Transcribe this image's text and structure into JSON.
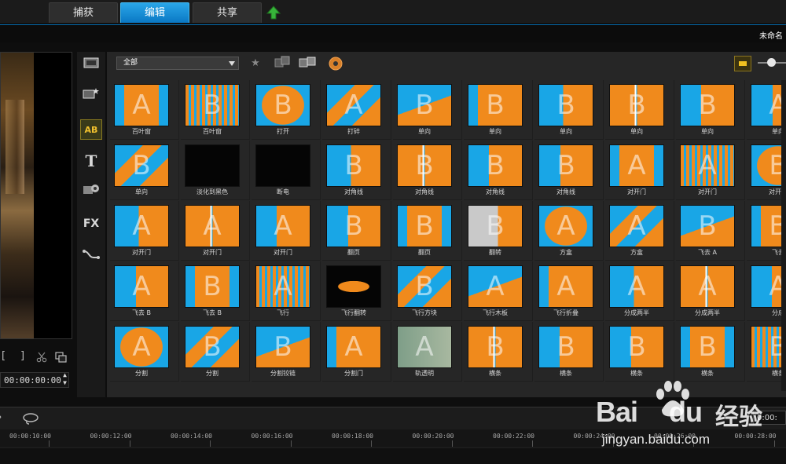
{
  "tabs": [
    {
      "label": "捕获",
      "active": false
    },
    {
      "label": "编辑",
      "active": true
    },
    {
      "label": "共享",
      "active": false
    }
  ],
  "project_name": "未命名",
  "preview": {
    "timecode": "00:00:00:00",
    "mark_in": "[",
    "mark_out": "]"
  },
  "library": {
    "category_selected": "全部",
    "rows": [
      [
        {
          "label": "百叶窗",
          "letter": "A"
        },
        {
          "label": "百叶窗",
          "letter": "B"
        },
        {
          "label": "打开",
          "letter": "B"
        },
        {
          "label": "打碎",
          "letter": "A"
        },
        {
          "label": "单向",
          "letter": "B"
        },
        {
          "label": "单向",
          "letter": "B"
        },
        {
          "label": "单向",
          "letter": "B"
        },
        {
          "label": "单向",
          "letter": "B"
        },
        {
          "label": "单向",
          "letter": "B"
        },
        {
          "label": "单向",
          "letter": "A"
        }
      ],
      [
        {
          "label": "单向",
          "letter": "B"
        },
        {
          "label": "淡化到黑色",
          "letter": ""
        },
        {
          "label": "断电",
          "letter": ""
        },
        {
          "label": "对角线",
          "letter": "B"
        },
        {
          "label": "对角线",
          "letter": "B"
        },
        {
          "label": "对角线",
          "letter": "B"
        },
        {
          "label": "对角线",
          "letter": "B"
        },
        {
          "label": "对开门",
          "letter": "A"
        },
        {
          "label": "对开门",
          "letter": "A"
        },
        {
          "label": "对开门",
          "letter": "B"
        }
      ],
      [
        {
          "label": "对开门",
          "letter": "A"
        },
        {
          "label": "对开门",
          "letter": "A"
        },
        {
          "label": "对开门",
          "letter": "A"
        },
        {
          "label": "翻页",
          "letter": "B"
        },
        {
          "label": "翻页",
          "letter": "B"
        },
        {
          "label": "翻转",
          "letter": "B"
        },
        {
          "label": "方盒",
          "letter": "A"
        },
        {
          "label": "方盒",
          "letter": "A"
        },
        {
          "label": "飞去 A",
          "letter": "B"
        },
        {
          "label": "飞去",
          "letter": "B"
        }
      ],
      [
        {
          "label": "飞去 B",
          "letter": "A"
        },
        {
          "label": "飞去 B",
          "letter": "B"
        },
        {
          "label": "飞行",
          "letter": "A"
        },
        {
          "label": "飞行翻转",
          "letter": ""
        },
        {
          "label": "飞行方块",
          "letter": "B"
        },
        {
          "label": "飞行木板",
          "letter": "A"
        },
        {
          "label": "飞行折叠",
          "letter": "A"
        },
        {
          "label": "分成两半",
          "letter": "A"
        },
        {
          "label": "分成两半",
          "letter": "A"
        },
        {
          "label": "分成",
          "letter": "A"
        }
      ],
      [
        {
          "label": "分割",
          "letter": "A"
        },
        {
          "label": "分割",
          "letter": "B"
        },
        {
          "label": "分割铰链",
          "letter": "B"
        },
        {
          "label": "分割门",
          "letter": "A"
        },
        {
          "label": "轨透明",
          "letter": "A"
        },
        {
          "label": "横条",
          "letter": "B"
        },
        {
          "label": "横条",
          "letter": "B"
        },
        {
          "label": "横条",
          "letter": "B"
        },
        {
          "label": "横条",
          "letter": "B"
        },
        {
          "label": "横条",
          "letter": "B"
        }
      ]
    ]
  },
  "timeline": {
    "ticks": [
      "00:00:10:00",
      "00:00:12:00",
      "00:00:14:00",
      "00:00:16:00",
      "00:00:18:00",
      "00:00:20:00",
      "00:00:22:00",
      "00:00:24:00",
      "00:00:26:00",
      "00:00:28:00"
    ],
    "current_time": "0:00:"
  },
  "watermark": {
    "brand": "Bai",
    "brand2": "du",
    "cn": "经验",
    "url": "jingyan.baidu.com"
  },
  "colors": {
    "orange": "#f08a1c",
    "blue": "#19a6e6",
    "accent": "#1a8fd8"
  }
}
